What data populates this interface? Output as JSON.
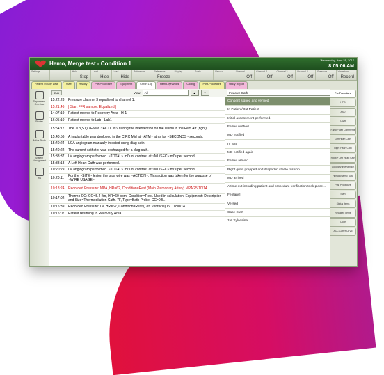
{
  "window": {
    "title": "Hemo, Merge test - Condition 1",
    "date": "Wednesday, June 21, 2017",
    "time": "8:05:06 AM"
  },
  "toolbar": [
    {
      "top": "Settings",
      "main": ""
    },
    {
      "top": "",
      "main": ""
    },
    {
      "top": "Hold",
      "main": "Stop"
    },
    {
      "top": "Lead",
      "main": "Hide"
    },
    {
      "top": "Lead",
      "main": "Hide"
    },
    {
      "top": "Reference",
      "main": ""
    },
    {
      "top": "Reference",
      "main": "Freeze"
    },
    {
      "top": "Display",
      "main": ""
    },
    {
      "top": "Scale",
      "main": ""
    },
    {
      "top": "Record",
      "main": ""
    },
    {
      "top": "Channel 1",
      "main": "Off"
    },
    {
      "top": "Channel 2",
      "main": "Off"
    },
    {
      "top": "Channel 3",
      "main": "Off"
    },
    {
      "top": "Channel 4",
      "main": "Off"
    },
    {
      "top": "Pressure",
      "main": "Off"
    },
    {
      "top": "Waveform",
      "main": "Record"
    }
  ],
  "tabs": [
    {
      "label": "Patient / Study Data",
      "color": "#f3f0a0"
    },
    {
      "label": "Staff",
      "color": "#f3f0a0"
    },
    {
      "label": "History",
      "color": "#f3f0a0"
    },
    {
      "label": "Pre-Procedure",
      "color": "#f2b8d9"
    },
    {
      "label": "Equipment",
      "color": "#f2b8d9"
    },
    {
      "label": "Chron Log",
      "color": "#ffffff"
    },
    {
      "label": "Hemo-dynamics",
      "color": "#f2b8d9"
    },
    {
      "label": "Coding",
      "color": "#f2b8d9"
    },
    {
      "label": "Post-Procedure",
      "color": "#f3f0a0"
    },
    {
      "label": "Study Report",
      "color": "#f2b8d9"
    }
  ],
  "sidebar": [
    {
      "label": "Department Overview"
    },
    {
      "label": "Studies"
    },
    {
      "label": "Active Study"
    },
    {
      "label": "System Management"
    },
    {
      "label": "HIS"
    }
  ],
  "log": {
    "edit_label": "Edit",
    "view_label": "View",
    "view_value": "All",
    "rows": [
      {
        "time": "15:22:28",
        "text": "Pressure channel 3 equalized to channel 1.",
        "red": false
      },
      {
        "time": "15:21:46",
        "text": "| Start FFR sample: Equalized |",
        "red": true
      },
      {
        "time": "14:07:19",
        "text": "Patient moved to Recovery Area - H-1",
        "red": false
      },
      {
        "time": "16:05:10",
        "text": "Patient moved to Lab - Lab1",
        "red": false
      },
      {
        "time": "15:54:17",
        "text": "The JL3(ST) 7F was ~ACTION~ during the intervention on the lesion in the Fem Art (right).",
        "red": false
      },
      {
        "time": "15:40:56",
        "text": "A implantable was deployed in the CIRC Mid at ~ATM~ atms for ~SECONDS~ seconds.",
        "red": false
      },
      {
        "time": "15:40:24",
        "text": "LCA angiogram manually injected using diag cath.",
        "red": false
      },
      {
        "time": "15:40:22",
        "text": "The current catheter was exchanged for a diag cath.",
        "red": false
      },
      {
        "time": "15:38:37",
        "text": "LV angiogram performed. ~TOTAL~ ml's of contrast at ~ML/SEC~ ml's per second.",
        "red": false
      },
      {
        "time": "15:38:18",
        "text": "A Left Heart Cath was performed.",
        "red": false
      },
      {
        "time": "10:20:29",
        "text": "LV angiogram performed. ~TOTAL~ ml's of contrast at ~ML/SEC~ ml's per second.",
        "red": false
      },
      {
        "time": "10:20:11",
        "text": "For the ~SITE~ lesion the ptca wire was ~ACTION~. This action was taken for the purpose of ~WIRE USAGE~",
        "red": false
      },
      {
        "time": "10:18:24",
        "text": "Recorded Pressure: MPA, HR=62, Condition=Rest (Main Pulmonary Artery) MPA 25/10/14",
        "red": true
      },
      {
        "time": "10:17:02",
        "text": "Thermo CO: CO=5.4 l/m, HR=60 bpm, Condition=Rest. Used in calculation. Equipment: Description and Size=Thermodilution Cath. 7F, Type=Bath Probe, CC=0.5..",
        "red": false
      },
      {
        "time": "10:15:39",
        "text": "Recorded Pressure: LV, HR=62, Condition=Rest (Left Ventricle) LV 118/0/14",
        "red": false
      },
      {
        "time": "10:15:07",
        "text": "Patient returning to Recovery Area",
        "red": false
      }
    ]
  },
  "procedure": {
    "select_value": "Invasive Cath",
    "items": [
      "Consent signed and verified",
      "In Patient/Out Patient",
      "Initial assessment performed.",
      "Fellow notified",
      "MD notified",
      "IV Site",
      "MD notified again",
      "Fellow arrived",
      "Right groin prepped and draped in sterile fashion.",
      "MD arrived",
      "A time out including patient and procedure verification took place...",
      "Fentanyl",
      "Versed",
      "Case Start",
      "1% Xylocaine"
    ]
  },
  "right_tabs": [
    "Pre Procedure",
    "HPG",
    "ASD",
    "TAVR",
    "Family Wait Comments",
    "Left Heart Cath",
    "Right Heart Cath",
    "Right + Left Heart Cath",
    "Coronary Intervention",
    "Hemodynamic Data",
    "Post Procedure",
    "Start",
    "Status Items",
    "Required Items",
    "Code",
    "ACC Cath/PCI V5"
  ]
}
